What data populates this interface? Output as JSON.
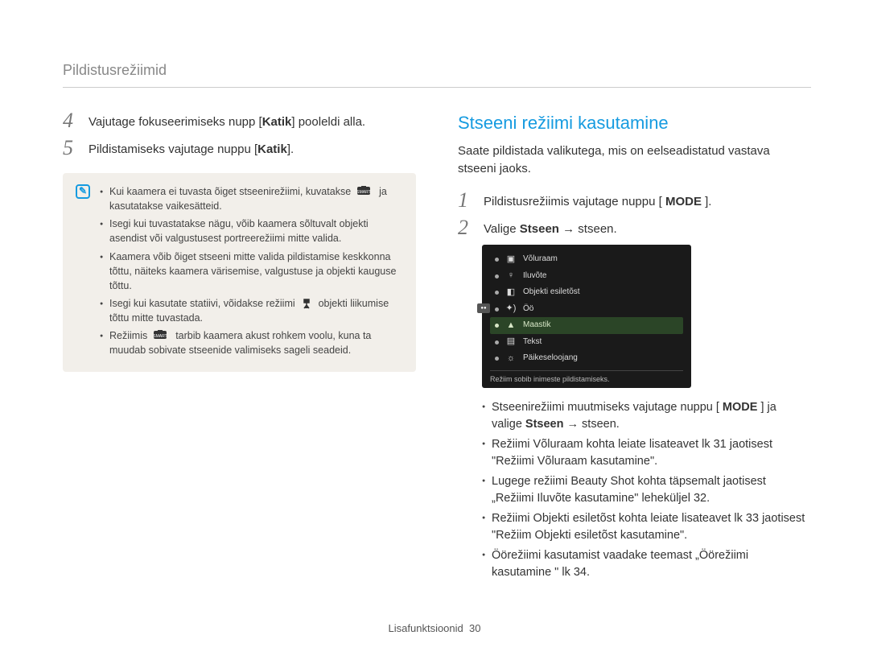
{
  "header": {
    "title": "Pildistusrežiimid"
  },
  "left": {
    "step4": {
      "num": "4",
      "pre": "Vajutage fokuseerimiseks nupp [",
      "key": "Katik",
      "post": "] pooleldi alla."
    },
    "step5": {
      "num": "5",
      "pre": "Pildistamiseks vajutage nuppu [",
      "key": "Katik",
      "post": "]."
    },
    "note": {
      "b1a": "Kui kaamera ei tuvasta õiget stseenirežiimi, kuvatakse ",
      "b1b": " ja kasutatakse vaikesätteid.",
      "b2": "Isegi kui tuvastatakse nägu, võib kaamera sõltuvalt objekti asendist või valgustusest portreerežiimi mitte valida.",
      "b3": "Kaamera võib õiget stseeni mitte valida pildistamise keskkonna tõttu, näiteks kaamera värisemise, valgustuse ja objekti kauguse tõttu.",
      "b4a": "Isegi kui kasutate statiivi, võidakse režiimi ",
      "b4b": " objekti liikumise tõttu mitte tuvastada.",
      "b5a": "Režiimis ",
      "b5b": " tarbib kaamera akust rohkem voolu, kuna ta muudab sobivate stseenide valimiseks sageli seadeid."
    }
  },
  "right": {
    "title": "Stseeni režiimi kasutamine",
    "intro": "Saate pildistada valikutega, mis on eelseadistatud vastava stseeni jaoks.",
    "step1": {
      "num": "1",
      "pre": "Pildistusrežiimis vajutage nuppu [ ",
      "key": "MODE",
      "post": " ]."
    },
    "step2": {
      "num": "2",
      "pre": "Valige ",
      "key": "Stseen",
      "post": " → stseen."
    },
    "lcd": {
      "items": [
        {
          "label": "Võluraam"
        },
        {
          "label": "Iluvõte"
        },
        {
          "label": "Objekti esiletõst"
        },
        {
          "label": "Öö"
        },
        {
          "label": "Maastik",
          "selected": true
        },
        {
          "label": "Tekst"
        },
        {
          "label": "Päikeseloojang"
        }
      ],
      "hint": "Režiim sobib inimeste pildistamiseks."
    },
    "bullets": {
      "b1a": "Stseenirežiimi muutmiseks vajutage nuppu [ ",
      "b1key": "MODE",
      "b1b": " ] ja valige ",
      "b1key2": "Stseen",
      "b1c": " → stseen.",
      "b2": "Režiimi Võluraam kohta leiate lisateavet lk 31 jaotisest \"Režiimi Võluraam kasutamine\".",
      "b3": "Lugege režiimi Beauty Shot kohta täpsemalt jaotisest „Režiimi Iluvõte kasutamine\" leheküljel 32.",
      "b4": "Režiimi Objekti esiletõst kohta leiate lisateavet lk 33 jaotisest \"Režiim Objekti esiletõst kasutamine\".",
      "b5": "Öörežiimi kasutamist vaadake teemast „Öörežiimi kasutamine \" lk 34."
    }
  },
  "footer": {
    "section": "Lisafunktsioonid",
    "page": "30"
  }
}
